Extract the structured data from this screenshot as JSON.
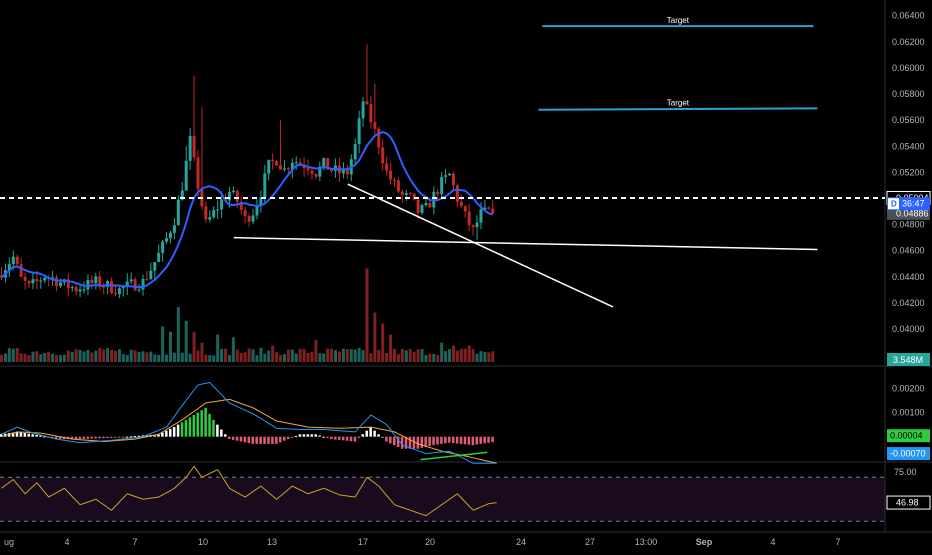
{
  "colors": {
    "background": "#000000",
    "up": "#26a69a",
    "down": "#c62828",
    "ma": "#2962ff",
    "macd_line": "#2196f3",
    "signal_line": "#f2a93b",
    "rsi_line": "#c9a227",
    "rsi_band": "#1a0a1e",
    "target_line": "#2c9fd6",
    "trend_line": "#ffffff",
    "axis_text": "#b2b5be",
    "separator": "#2a2e39",
    "price_label": "#ffffff",
    "volume_badge": "#26a69a",
    "macd_badge": "#2ecc40",
    "signal_badge": "#2196f3"
  },
  "chart_data": [
    {
      "type": "candlestick",
      "title": "",
      "ylim": [
        0.0384,
        0.0652
      ],
      "y_ticks": [
        "0.06400",
        "0.06200",
        "0.06000",
        "0.05800",
        "0.05600",
        "0.05400",
        "0.05200",
        "0.05000",
        "0.04800",
        "0.04600",
        "0.04400",
        "0.04200",
        "0.04000"
      ],
      "x_ticks": [
        "ug",
        "4",
        "7",
        "10",
        "13",
        "17",
        "20",
        "24",
        "27",
        "13:00",
        "Sep",
        "4",
        "7"
      ],
      "x_ticks_bold": [
        "Sep"
      ],
      "path_points": [
        [
          0,
          0.0441
        ],
        [
          4,
          0.0455
        ],
        [
          6,
          0.0438
        ],
        [
          8,
          0.0432
        ],
        [
          10,
          0.0436
        ],
        [
          12,
          0.0441
        ],
        [
          14,
          0.0439
        ],
        [
          17,
          0.0434
        ],
        [
          20,
          0.0431
        ],
        [
          23,
          0.0434
        ],
        [
          25,
          0.0436
        ],
        [
          28,
          0.0433
        ],
        [
          31,
          0.043
        ],
        [
          34,
          0.0434
        ],
        [
          37,
          0.0436
        ],
        [
          39,
          0.0446
        ],
        [
          41,
          0.0457
        ],
        [
          43,
          0.0469
        ],
        [
          45,
          0.0484
        ],
        [
          47,
          0.051
        ],
        [
          49,
          0.0544
        ],
        [
          51,
          0.051
        ],
        [
          53,
          0.048
        ],
        [
          55,
          0.0489
        ],
        [
          57,
          0.0498
        ],
        [
          59,
          0.0505
        ],
        [
          61,
          0.0498
        ],
        [
          63,
          0.0484
        ],
        [
          65,
          0.049
        ],
        [
          67,
          0.0505
        ],
        [
          69,
          0.0525
        ],
        [
          71,
          0.053
        ],
        [
          73,
          0.0522
        ],
        [
          75,
          0.053
        ],
        [
          77,
          0.0527
        ],
        [
          79,
          0.0525
        ],
        [
          81,
          0.052
        ],
        [
          83,
          0.0526
        ],
        [
          85,
          0.0522
        ],
        [
          87,
          0.052
        ],
        [
          89,
          0.052
        ],
        [
          91,
          0.054
        ],
        [
          93,
          0.0575
        ],
        [
          95,
          0.056
        ],
        [
          97,
          0.0542
        ],
        [
          99,
          0.052
        ],
        [
          101,
          0.051
        ],
        [
          103,
          0.0502
        ],
        [
          105,
          0.05
        ],
        [
          107,
          0.049
        ],
        [
          109,
          0.0492
        ],
        [
          111,
          0.0502
        ],
        [
          113,
          0.0512
        ],
        [
          115,
          0.0518
        ],
        [
          117,
          0.05
        ],
        [
          119,
          0.0486
        ],
        [
          121,
          0.0475
        ],
        [
          123,
          0.0488
        ],
        [
          125,
          0.049
        ],
        [
          126,
          0.04886
        ]
      ],
      "candle_count": 126,
      "last_price": 0.04886,
      "ma_period": 9,
      "dashed_level": 0.05004,
      "price_labels": [
        {
          "text": "0.05004",
          "value": 0.05004,
          "style": "outline"
        },
        {
          "text": "0.04886",
          "value": 0.04886,
          "style": "grey"
        }
      ],
      "countdown": {
        "marker": "D",
        "time": "36:47",
        "value": 0.0496
      },
      "targets": [
        {
          "label": "Target",
          "x1": 138,
          "x2": 207,
          "y1": 0.0632,
          "y2": 0.0632
        },
        {
          "label": "Target",
          "x1": 137,
          "x2": 208,
          "y1": 0.0568,
          "y2": 0.0569
        }
      ],
      "trend_lines": [
        {
          "x1": 59.5,
          "y1": 0.047,
          "x2": 208,
          "y2": 0.0461
        },
        {
          "x1": 88.5,
          "y1": 0.0511,
          "x2": 156,
          "y2": 0.0417
        }
      ],
      "volume": {
        "badge": "3.548M",
        "spikes": [
          [
            41,
            0.65
          ],
          [
            43,
            0.55
          ],
          [
            45,
            1.0
          ],
          [
            47,
            0.75
          ],
          [
            49,
            0.55
          ],
          [
            51,
            0.35
          ],
          [
            55,
            0.5
          ],
          [
            59,
            0.45
          ],
          [
            69,
            0.3
          ],
          [
            80,
            0.4
          ],
          [
            93,
            1.7
          ],
          [
            95,
            0.9
          ],
          [
            97,
            0.7
          ],
          [
            99,
            0.5
          ],
          [
            112,
            0.35
          ],
          [
            115,
            0.3
          ],
          [
            119,
            0.3
          ]
        ]
      }
    },
    {
      "type": "line",
      "name": "macd",
      "ylim": [
        -0.00105,
        0.00285
      ],
      "y_ticks": [
        "0.00200",
        "0.00100"
      ],
      "macd_points": [
        [
          0,
          0.0001
        ],
        [
          4,
          0.0004
        ],
        [
          8,
          0.00015
        ],
        [
          14,
          -0.0001
        ],
        [
          20,
          -0.00025
        ],
        [
          28,
          -0.00015
        ],
        [
          36,
          0.0
        ],
        [
          42,
          0.0004
        ],
        [
          46,
          0.0013
        ],
        [
          50,
          0.00215
        ],
        [
          53,
          0.00225
        ],
        [
          58,
          0.0014
        ],
        [
          64,
          0.00095
        ],
        [
          70,
          0.00035
        ],
        [
          76,
          0.0003
        ],
        [
          82,
          0.0003
        ],
        [
          90,
          0.0002
        ],
        [
          94,
          0.0009
        ],
        [
          98,
          0.0005
        ],
        [
          102,
          -0.00035
        ],
        [
          108,
          -0.0007
        ],
        [
          114,
          -0.0006
        ],
        [
          120,
          -0.0011
        ],
        [
          126,
          -0.0011
        ]
      ],
      "signal_points": [
        [
          0,
          0.0
        ],
        [
          4,
          0.0002
        ],
        [
          10,
          0.00015
        ],
        [
          18,
          -0.0001
        ],
        [
          26,
          -0.0002
        ],
        [
          34,
          -0.0001
        ],
        [
          40,
          0.0001
        ],
        [
          46,
          0.0007
        ],
        [
          52,
          0.0014
        ],
        [
          58,
          0.00155
        ],
        [
          64,
          0.0012
        ],
        [
          70,
          0.00065
        ],
        [
          78,
          0.0004
        ],
        [
          86,
          0.00035
        ],
        [
          94,
          0.0004
        ],
        [
          100,
          0.0002
        ],
        [
          106,
          -0.0003
        ],
        [
          112,
          -0.0006
        ],
        [
          118,
          -0.0008
        ],
        [
          126,
          -0.0011
        ]
      ],
      "histogram_points": [
        [
          0,
          0.0001
        ],
        [
          4,
          0.0002
        ],
        [
          10,
          5e-05
        ],
        [
          14,
          -0.0001
        ],
        [
          20,
          -0.0001
        ],
        [
          28,
          -5e-05
        ],
        [
          36,
          5e-05
        ],
        [
          40,
          0.0001
        ],
        [
          44,
          0.0004
        ],
        [
          48,
          0.0008
        ],
        [
          52,
          0.0012
        ],
        [
          54,
          0.0007
        ],
        [
          58,
          -0.0001
        ],
        [
          64,
          -0.0003
        ],
        [
          70,
          -0.0003
        ],
        [
          76,
          0.0001
        ],
        [
          80,
          0.0001
        ],
        [
          84,
          -0.0001
        ],
        [
          90,
          -0.0002
        ],
        [
          94,
          0.0004
        ],
        [
          98,
          -0.0002
        ],
        [
          102,
          -0.0005
        ],
        [
          106,
          -0.0005
        ],
        [
          110,
          -0.00035
        ],
        [
          114,
          -0.00025
        ],
        [
          120,
          -0.00035
        ],
        [
          126,
          -0.0002
        ]
      ],
      "badges": [
        {
          "text": "0.00004",
          "value": 4e-05,
          "color": "macd_badge"
        },
        {
          "text": "-0.00070",
          "value": -0.0007,
          "color": "signal_badge"
        }
      ]
    },
    {
      "type": "line",
      "name": "rsi",
      "ylim": [
        22,
        83
      ],
      "y_ticks": [
        "75.00"
      ],
      "band": [
        30,
        70
      ],
      "points": [
        [
          0,
          60
        ],
        [
          3,
          68
        ],
        [
          6,
          55
        ],
        [
          9,
          65
        ],
        [
          12,
          52
        ],
        [
          16,
          60
        ],
        [
          20,
          45
        ],
        [
          24,
          50
        ],
        [
          28,
          40
        ],
        [
          32,
          55
        ],
        [
          36,
          50
        ],
        [
          40,
          52
        ],
        [
          44,
          60
        ],
        [
          47,
          70
        ],
        [
          49,
          80
        ],
        [
          51,
          70
        ],
        [
          55,
          77
        ],
        [
          58,
          60
        ],
        [
          62,
          52
        ],
        [
          66,
          62
        ],
        [
          70,
          50
        ],
        [
          74,
          62
        ],
        [
          78,
          55
        ],
        [
          82,
          60
        ],
        [
          86,
          54
        ],
        [
          90,
          52
        ],
        [
          93,
          70
        ],
        [
          96,
          62
        ],
        [
          100,
          45
        ],
        [
          104,
          40
        ],
        [
          108,
          35
        ],
        [
          112,
          45
        ],
        [
          116,
          55
        ],
        [
          120,
          40
        ],
        [
          124,
          46
        ],
        [
          126,
          46.98
        ]
      ],
      "badge": {
        "text": "46.98",
        "value": 46.98
      }
    }
  ]
}
